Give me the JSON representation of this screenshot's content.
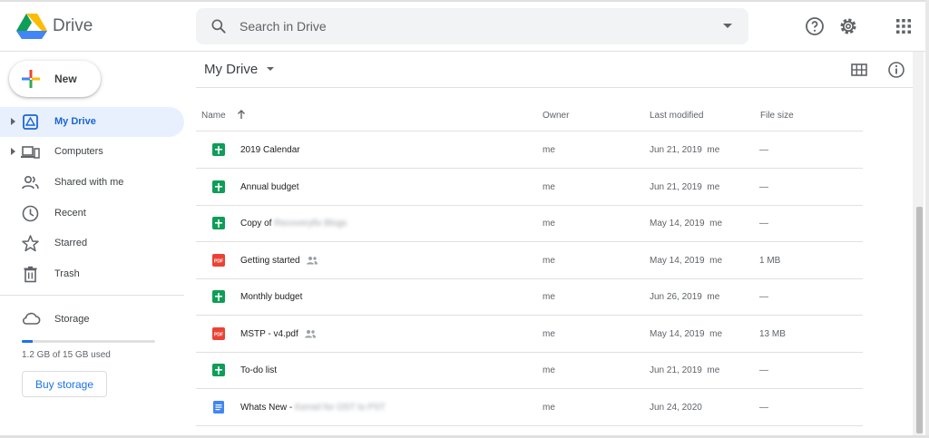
{
  "app": {
    "title": "Drive"
  },
  "search": {
    "placeholder": "Search in Drive"
  },
  "header_icons": [
    "help-icon",
    "settings-gear-icon",
    "apps-grid-icon"
  ],
  "new_button": {
    "label": "New"
  },
  "sidebar": {
    "items": [
      {
        "label": "My Drive",
        "icon": "my-drive-icon",
        "active": true,
        "expandable": true
      },
      {
        "label": "Computers",
        "icon": "computers-icon",
        "active": false,
        "expandable": true
      },
      {
        "label": "Shared with me",
        "icon": "shared-people-icon",
        "active": false,
        "expandable": false
      },
      {
        "label": "Recent",
        "icon": "clock-icon",
        "active": false,
        "expandable": false
      },
      {
        "label": "Starred",
        "icon": "star-icon",
        "active": false,
        "expandable": false
      },
      {
        "label": "Trash",
        "icon": "trash-icon",
        "active": false,
        "expandable": false
      }
    ]
  },
  "storage": {
    "label": "Storage",
    "usage_text": "1.2 GB of 15 GB used",
    "used_fraction": 0.08,
    "buy_label": "Buy storage"
  },
  "main": {
    "breadcrumb": "My Drive",
    "columns": {
      "name": "Name",
      "owner": "Owner",
      "modified": "Last modified",
      "size": "File size"
    },
    "files": [
      {
        "type": "sheet",
        "name": "2019 Calendar",
        "name_blurred": "",
        "shared": false,
        "owner": "me",
        "modified": "Jun 21, 2019",
        "modified_by": "me",
        "size": "—"
      },
      {
        "type": "sheet",
        "name": "Annual budget",
        "name_blurred": "",
        "shared": false,
        "owner": "me",
        "modified": "Jun 21, 2019",
        "modified_by": "me",
        "size": "—"
      },
      {
        "type": "sheet",
        "name": "Copy of ",
        "name_blurred": "Recoveryfix Blogs",
        "shared": false,
        "owner": "me",
        "modified": "May 14, 2019",
        "modified_by": "me",
        "size": "—"
      },
      {
        "type": "pdf",
        "name": "Getting started",
        "name_blurred": "",
        "shared": true,
        "owner": "me",
        "modified": "May 14, 2019",
        "modified_by": "me",
        "size": "1 MB"
      },
      {
        "type": "sheet",
        "name": "Monthly budget",
        "name_blurred": "",
        "shared": false,
        "owner": "me",
        "modified": "Jun 26, 2019",
        "modified_by": "me",
        "size": "—"
      },
      {
        "type": "pdf",
        "name": "MSTP - v4.pdf",
        "name_blurred": "",
        "shared": true,
        "owner": "me",
        "modified": "May 14, 2019",
        "modified_by": "me",
        "size": "13 MB"
      },
      {
        "type": "sheet",
        "name": "To-do list",
        "name_blurred": "",
        "shared": false,
        "owner": "me",
        "modified": "Jun 21, 2019",
        "modified_by": "me",
        "size": "—"
      },
      {
        "type": "doc",
        "name": "Whats New - ",
        "name_blurred": "Kernel for OST to PST",
        "shared": false,
        "owner": "me",
        "modified": "Jun 24, 2020",
        "modified_by": "",
        "size": "—"
      }
    ]
  },
  "colors": {
    "accent": "#1a73e8",
    "active_nav_bg": "#e8f0fe",
    "sheet_green": "#0f9d58",
    "pdf_red": "#ea4335",
    "doc_blue": "#4285f4"
  }
}
